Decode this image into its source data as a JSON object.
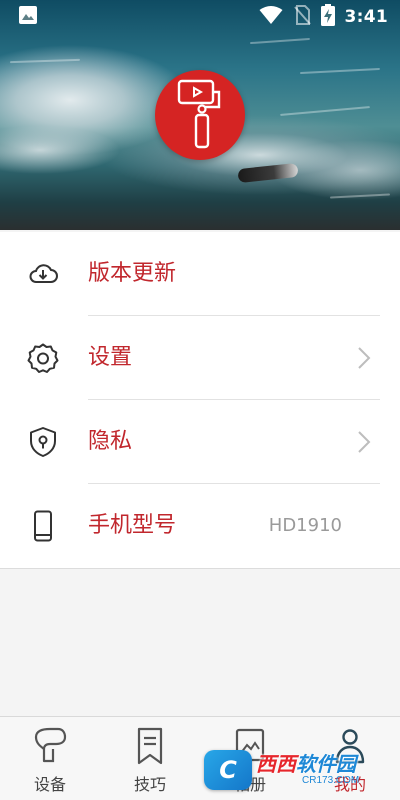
{
  "status_bar": {
    "time": "3:41",
    "icons": [
      "image-icon",
      "wifi-icon",
      "no-sim-icon",
      "battery-charging-icon"
    ]
  },
  "header": {
    "logo_icon": "gimbal-stabilizer-icon",
    "logo_color": "#d52423"
  },
  "menu": {
    "accent_color": "#c1272d",
    "items": [
      {
        "label": "版本更新",
        "icon": "download-cloud-icon",
        "value": "",
        "chevron": false
      },
      {
        "label": "设置",
        "icon": "gear-icon",
        "value": "",
        "chevron": true
      },
      {
        "label": "隐私",
        "icon": "shield-lock-icon",
        "value": "",
        "chevron": true
      },
      {
        "label": "手机型号",
        "icon": "phone-icon",
        "value": "HD1910",
        "chevron": false
      }
    ]
  },
  "bottom_nav": {
    "tabs": [
      {
        "label": "设备",
        "icon": "device-gimbal-icon",
        "active": false
      },
      {
        "label": "技巧",
        "icon": "bookmark-icon",
        "active": false
      },
      {
        "label": "相册",
        "icon": "album-icon",
        "active": false
      },
      {
        "label": "我的",
        "icon": "person-icon",
        "active": true
      }
    ]
  },
  "watermark": {
    "badge": "C",
    "title_red": "西西",
    "title_blue": "软件园",
    "url": "CR173.COM"
  }
}
